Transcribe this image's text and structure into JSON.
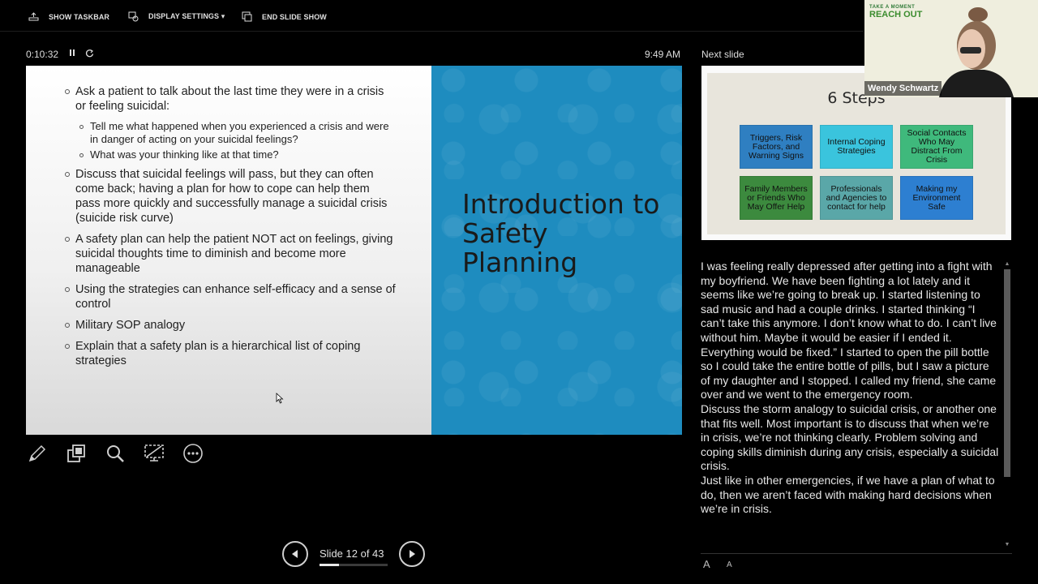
{
  "toolbar": {
    "show_taskbar": "SHOW TASKBAR",
    "display_settings": "DISPLAY SETTINGS ▾",
    "end_slide_show": "END SLIDE SHOW"
  },
  "timer": {
    "elapsed": "0:10:32"
  },
  "clock": "9:49 AM",
  "next_slide_label": "Next slide",
  "current_slide": {
    "title": "Introduction to Safety Planning",
    "bullets": [
      {
        "text": "Ask a patient to talk about the last time they were in a crisis or feeling suicidal:",
        "sub": [
          "Tell me what happened when you experienced a crisis and were in danger of acting on your suicidal feelings?",
          "What was your thinking like at that time?"
        ]
      },
      {
        "text": "Discuss that suicidal feelings will pass, but they can often come back; having a plan for how to cope can help them pass more quickly and successfully manage a suicidal crisis (suicide risk curve)"
      },
      {
        "text": "A safety plan can help the patient NOT act on feelings, giving suicidal thoughts time to diminish and become more manageable"
      },
      {
        "text": "Using the strategies can enhance self-efficacy and a sense of control"
      },
      {
        "text": "Military SOP analogy"
      },
      {
        "text": "Explain that a safety plan is a hierarchical list of coping strategies"
      }
    ]
  },
  "next_slide": {
    "title": "6 Steps",
    "boxes": [
      {
        "label": "Triggers, Risk Factors, and Warning Signs",
        "color": "#2f7fc1"
      },
      {
        "label": "Internal Coping Strategies",
        "color": "#3ac4dd"
      },
      {
        "label": "Social Contacts Who May Distract From Crisis",
        "color": "#3fb97c"
      },
      {
        "label": "Family Members or Friends Who May Offer Help",
        "color": "#3c8a3e"
      },
      {
        "label": "Professionals and Agencies to contact for help",
        "color": "#5aa7a8"
      },
      {
        "label": "Making my Environment Safe",
        "color": "#2d7fd1"
      }
    ]
  },
  "webcam": {
    "brand_small": "TAKE A MOMENT",
    "brand_large": "REACH OUT",
    "participant_name": "Wendy Schwartz"
  },
  "notes": [
    "I was feeling really depressed after getting into a fight with my boyfriend.  We have been fighting a lot lately and it seems like we’re going to break up.  I started listening to sad music and had a couple drinks.  I started thinking “I can’t take this anymore.  I don’t know what to do.  I can’t live without him.  Maybe it would be easier if I ended it.  Everything would be fixed.”  I started to open the pill bottle so I could take the entire bottle of pills, but I saw a picture of my daughter and I stopped.  I called my friend, she came over and we went to the emergency room.",
    "Discuss the storm analogy to suicidal crisis, or another one that fits well.  Most important is to discuss that when we’re in crisis, we’re not thinking clearly.  Problem solving and coping skills diminish during any crisis, especially a suicidal crisis.",
    " Just like in other emergencies, if we have a plan of what to do, then we aren’t faced with making hard decisions when we’re in crisis."
  ],
  "navigation": {
    "slide_counter": "Slide 12 of 43",
    "progress_fraction": 0.28
  },
  "font_controls": {
    "increase": "A",
    "decrease": "A"
  }
}
